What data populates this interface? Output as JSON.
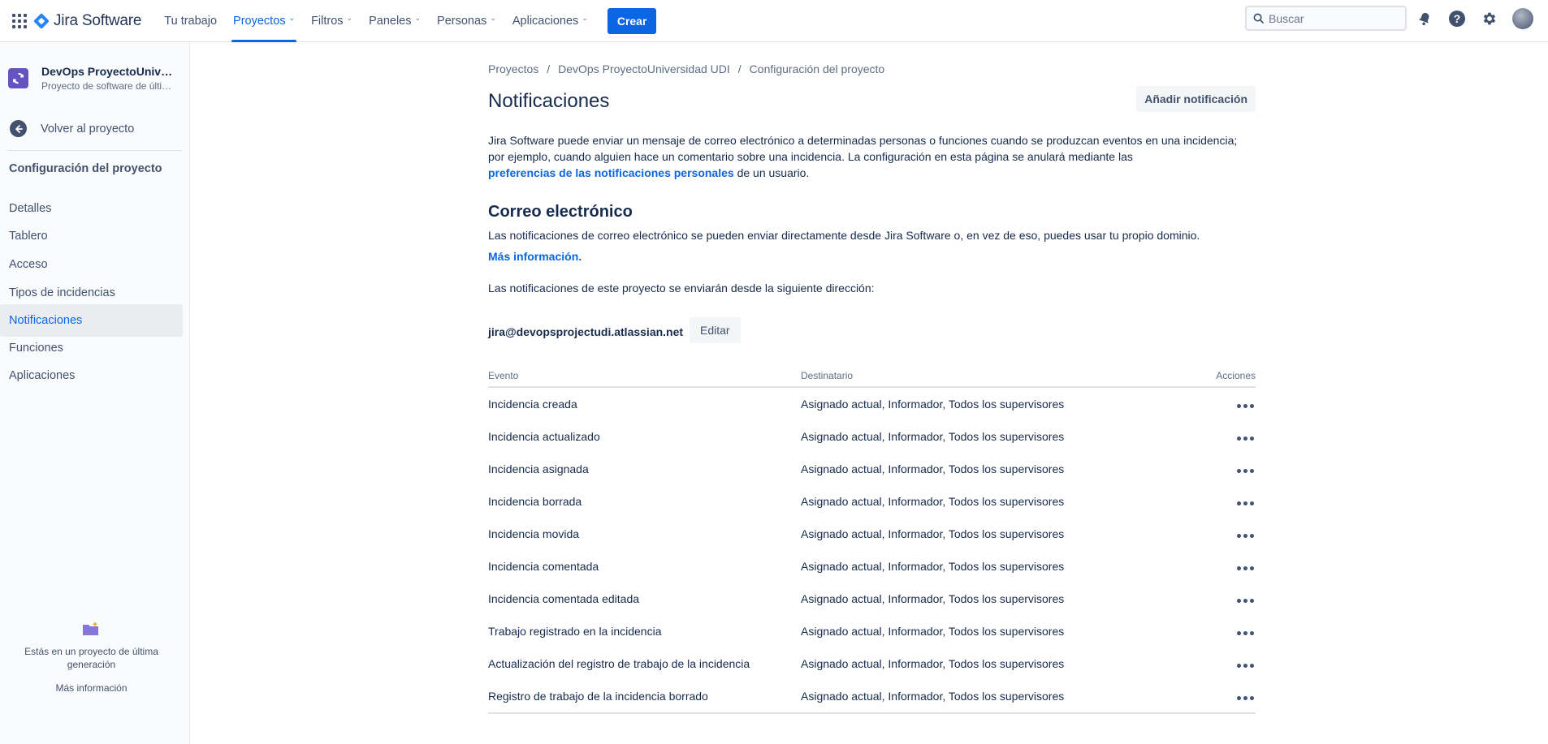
{
  "topnav": {
    "logo_text": "Jira Software",
    "items": [
      {
        "label": "Tu trabajo",
        "dropdown": false,
        "active": false
      },
      {
        "label": "Proyectos",
        "dropdown": true,
        "active": true
      },
      {
        "label": "Filtros",
        "dropdown": true,
        "active": false
      },
      {
        "label": "Paneles",
        "dropdown": true,
        "active": false
      },
      {
        "label": "Personas",
        "dropdown": true,
        "active": false
      },
      {
        "label": "Aplicaciones",
        "dropdown": true,
        "active": false
      }
    ],
    "create_label": "Crear",
    "search_placeholder": "Buscar",
    "accent_color": "#0c66e4"
  },
  "sidebar": {
    "project_name": "DevOps ProyectoUniversidad UDI",
    "project_type": "Proyecto de software de última generación",
    "back_label": "Volver al proyecto",
    "heading": "Configuración del proyecto",
    "items": [
      {
        "label": "Detalles",
        "active": false
      },
      {
        "label": "Tablero",
        "active": false
      },
      {
        "label": "Acceso",
        "active": false
      },
      {
        "label": "Tipos de incidencias",
        "active": false
      },
      {
        "label": "Notificaciones",
        "active": true
      },
      {
        "label": "Funciones",
        "active": false
      },
      {
        "label": "Aplicaciones",
        "active": false
      }
    ],
    "footer_text": "Estás en un proyecto de última generación",
    "footer_link": "Más información"
  },
  "main": {
    "breadcrumb": [
      "Proyectos",
      "DevOps ProyectoUniversidad UDI",
      "Configuración del proyecto"
    ],
    "title": "Notificaciones",
    "add_button": "Añadir notificación",
    "intro_text": "Jira Software puede enviar un mensaje de correo electrónico a determinadas personas o funciones cuando se produzcan eventos en una incidencia; por ejemplo, cuando alguien hace un comentario sobre una incidencia. La configuración en esta página se anulará mediante las",
    "intro_link": "preferencias de las notificaciones personales",
    "intro_suffix": " de un usuario.",
    "email_section_title": "Correo electrónico",
    "email_desc": "Las notificaciones de correo electrónico se pueden enviar directamente desde Jira Software o, en vez de eso, puedes usar tu propio dominio.",
    "more_info": "Más información.",
    "sender_desc": "Las notificaciones de este proyecto se enviarán desde la siguiente dirección:",
    "sender_email": "jira@devopsprojectudi.atlassian.net",
    "edit_button": "Editar",
    "table": {
      "headers": [
        "Evento",
        "Destinatario",
        "Acciones"
      ],
      "rows": [
        {
          "event": "Incidencia creada",
          "recipients": "Asignado actual, Informador, Todos los supervisores"
        },
        {
          "event": "Incidencia actualizado",
          "recipients": "Asignado actual, Informador, Todos los supervisores"
        },
        {
          "event": "Incidencia asignada",
          "recipients": "Asignado actual, Informador, Todos los supervisores"
        },
        {
          "event": "Incidencia borrada",
          "recipients": "Asignado actual, Informador, Todos los supervisores"
        },
        {
          "event": "Incidencia movida",
          "recipients": "Asignado actual, Informador, Todos los supervisores"
        },
        {
          "event": "Incidencia comentada",
          "recipients": "Asignado actual, Informador, Todos los supervisores"
        },
        {
          "event": "Incidencia comentada editada",
          "recipients": "Asignado actual, Informador, Todos los supervisores"
        },
        {
          "event": "Trabajo registrado en la incidencia",
          "recipients": "Asignado actual, Informador, Todos los supervisores"
        },
        {
          "event": "Actualización del registro de trabajo de la incidencia",
          "recipients": "Asignado actual, Informador, Todos los supervisores"
        },
        {
          "event": "Registro de trabajo de la incidencia borrado",
          "recipients": "Asignado actual, Informador, Todos los supervisores"
        }
      ]
    }
  }
}
